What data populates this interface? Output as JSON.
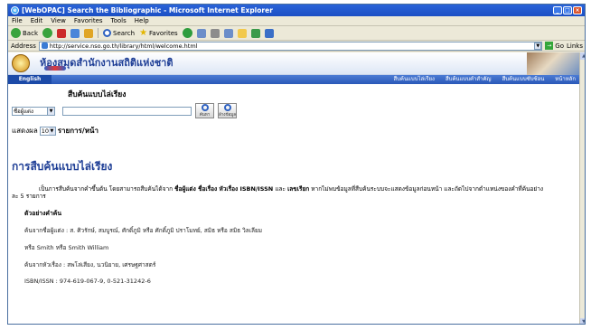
{
  "window": {
    "title": "[WebOPAC] Search the Bibliographic - Microsoft Internet Explorer"
  },
  "menu": [
    "File",
    "Edit",
    "View",
    "Favorites",
    "Tools",
    "Help"
  ],
  "toolbar": {
    "back": "Back",
    "search": "Search",
    "favorites": "Favorites"
  },
  "address": {
    "label": "Address",
    "url": "http://service.nso.go.th/library/html/welcome.html",
    "go": "Go",
    "links": "Links"
  },
  "banner": {
    "title": "ห้องสมุดสำนักงานสถิติแห่งชาติ"
  },
  "nav": {
    "english": "English",
    "links": [
      "สืบค้นแบบไล่เรียง",
      "สืบค้นแบบคำสำคัญ",
      "สืบค้นแบบซับซ้อน",
      "หน้าหลัก"
    ]
  },
  "search": {
    "heading": "สืบค้นแบบไล่เรียง",
    "field_selected": "ชื่อผู้แต่ง",
    "query_value": "",
    "search_btn": "ค้นหา",
    "clear_btn": "ล้างข้อมูล",
    "perpage_label": "แสดงผล",
    "perpage_value": "10",
    "perpage_unit": "รายการ/หน้า"
  },
  "content": {
    "section_title": "การสืบค้นแบบไล่เรียง",
    "desc_part1": "เป็นการสืบค้นจากคำขึ้นต้น โดยสามารถสืบค้นได้จาก",
    "desc_bold1": "ชื่อผู้แต่ง ชื่อเรื่อง หัวเรื่อง ISBN/ISSN",
    "desc_part2": "และ",
    "desc_bold2": "เลขเรียก",
    "desc_part3": "หากไม่พบข้อมูลที่สืบค้นระบบจะแสดงข้อมูลก่อนหน้า และถัดไปจากตำแหน่งของคำที่ค้นอย่าง",
    "desc_line2": "ละ 5 รายการ",
    "example_title": "ตัวอย่างคำค้น",
    "examples": [
      "ค้นจากชื่อผู้แต่ง : ส. ศิวรักษ์, สมบูรณ์, ศักดิ์ภูมิ หรือ ศักดิ์ภูมิ ปราโมทย์, สมิธ หรือ สมิธ วิลเลียม",
      "หรือ Smith หรือ Smith William",
      "ค้นจากหัวเรื่อง : สพโล่เสียง, นวนิยาย, เศรษฐศาสตร์",
      "ISBN/ISSN : 974-619-067-9, 0-521-31242-6"
    ]
  }
}
